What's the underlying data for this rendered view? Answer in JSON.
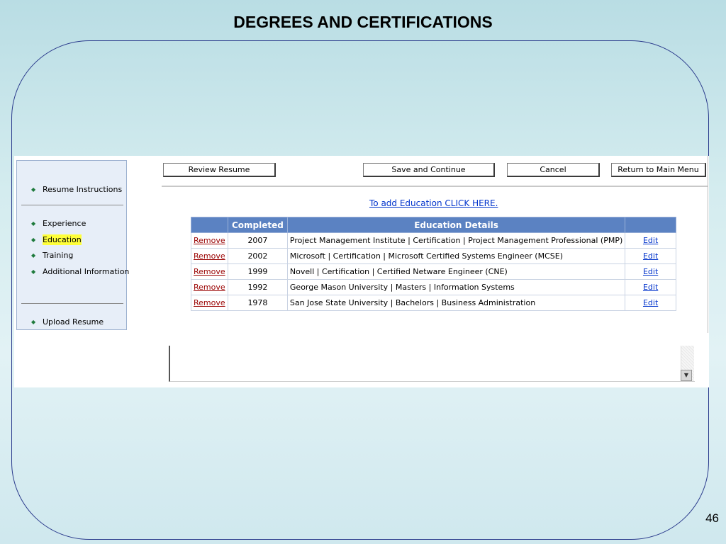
{
  "slide": {
    "title": "DEGREES  AND CERTIFICATIONS",
    "page_number": "46"
  },
  "nav": {
    "bullet": "◆",
    "items": [
      {
        "label": "Resume Instructions"
      },
      {
        "label": "Experience"
      },
      {
        "label": "Education",
        "selected": true
      },
      {
        "label": "Training"
      },
      {
        "label": "Additional Information"
      },
      {
        "label": "Upload Resume"
      }
    ]
  },
  "toolbar": {
    "review_label": "Review Resume",
    "save_label": "Save and Continue",
    "cancel_label": "Cancel",
    "return_label": "Return to Main Menu"
  },
  "add_link": "To add Education CLICK HERE.",
  "table": {
    "headers": [
      "",
      "Completed",
      "Education Details",
      ""
    ],
    "rows": [
      {
        "action": "Remove",
        "year": "2007",
        "details": "Project Management Institute | Certification | Project Management Professional (PMP)",
        "edit": "Edit"
      },
      {
        "action": "Remove",
        "year": "2002",
        "details": "Microsoft | Certification | Microsoft Certified Systems Engineer (MCSE)",
        "edit": "Edit"
      },
      {
        "action": "Remove",
        "year": "1999",
        "details": "Novell | Certification | Certified Netware Engineer (CNE)",
        "edit": "Edit"
      },
      {
        "action": "Remove",
        "year": "1992",
        "details": "George Mason University | Masters | Information Systems",
        "edit": "Edit"
      },
      {
        "action": "Remove",
        "year": "1978",
        "details": "San Jose State University | Bachelors | Business Administration",
        "edit": "Edit"
      }
    ]
  },
  "colors": {
    "header_bg": "#5b82c2",
    "remove_link": "#990000",
    "edit_link": "#0033cc",
    "highlight": "#ffff3a",
    "frame_border": "#2a3a8c"
  },
  "icons": {
    "bullet": "diamond-bullet-icon",
    "scroll_down": "chevron-down-icon"
  }
}
